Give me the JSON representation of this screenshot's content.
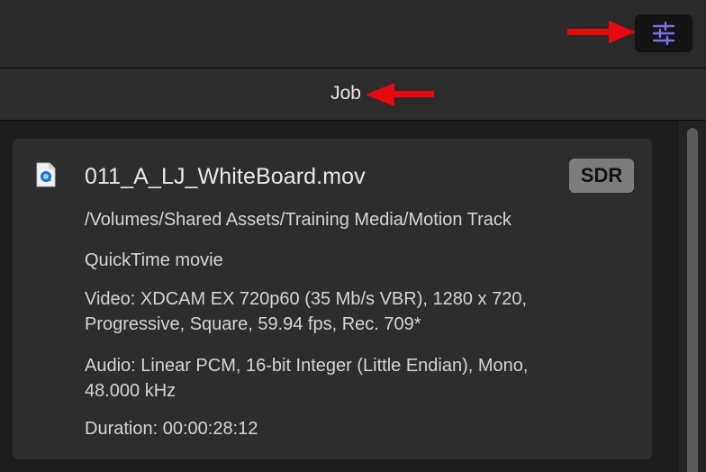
{
  "toolbar": {
    "inspector_button_icon": "sliders-icon",
    "inspector_button_color": "#7a72f0"
  },
  "tabs": {
    "job_label": "Job"
  },
  "annotations": {
    "arrow_color": "#e8090f"
  },
  "job": {
    "file_icon": "quicktime-file-icon",
    "filename": "011_A_LJ_WhiteBoard.mov",
    "badge": "SDR",
    "path": "/Volumes/Shared Assets/Training Media/Motion Track",
    "type": "QuickTime movie",
    "video_line1": "Video: XDCAM EX 720p60 (35 Mb/s VBR), 1280 x 720,",
    "video_line2": "Progressive, Square, 59.94 fps, Rec. 709*",
    "audio_line1": "Audio: Linear PCM, 16-bit Integer (Little Endian), Mono,",
    "audio_line2": "48.000 kHz",
    "duration": "Duration: 00:00:28:12"
  }
}
